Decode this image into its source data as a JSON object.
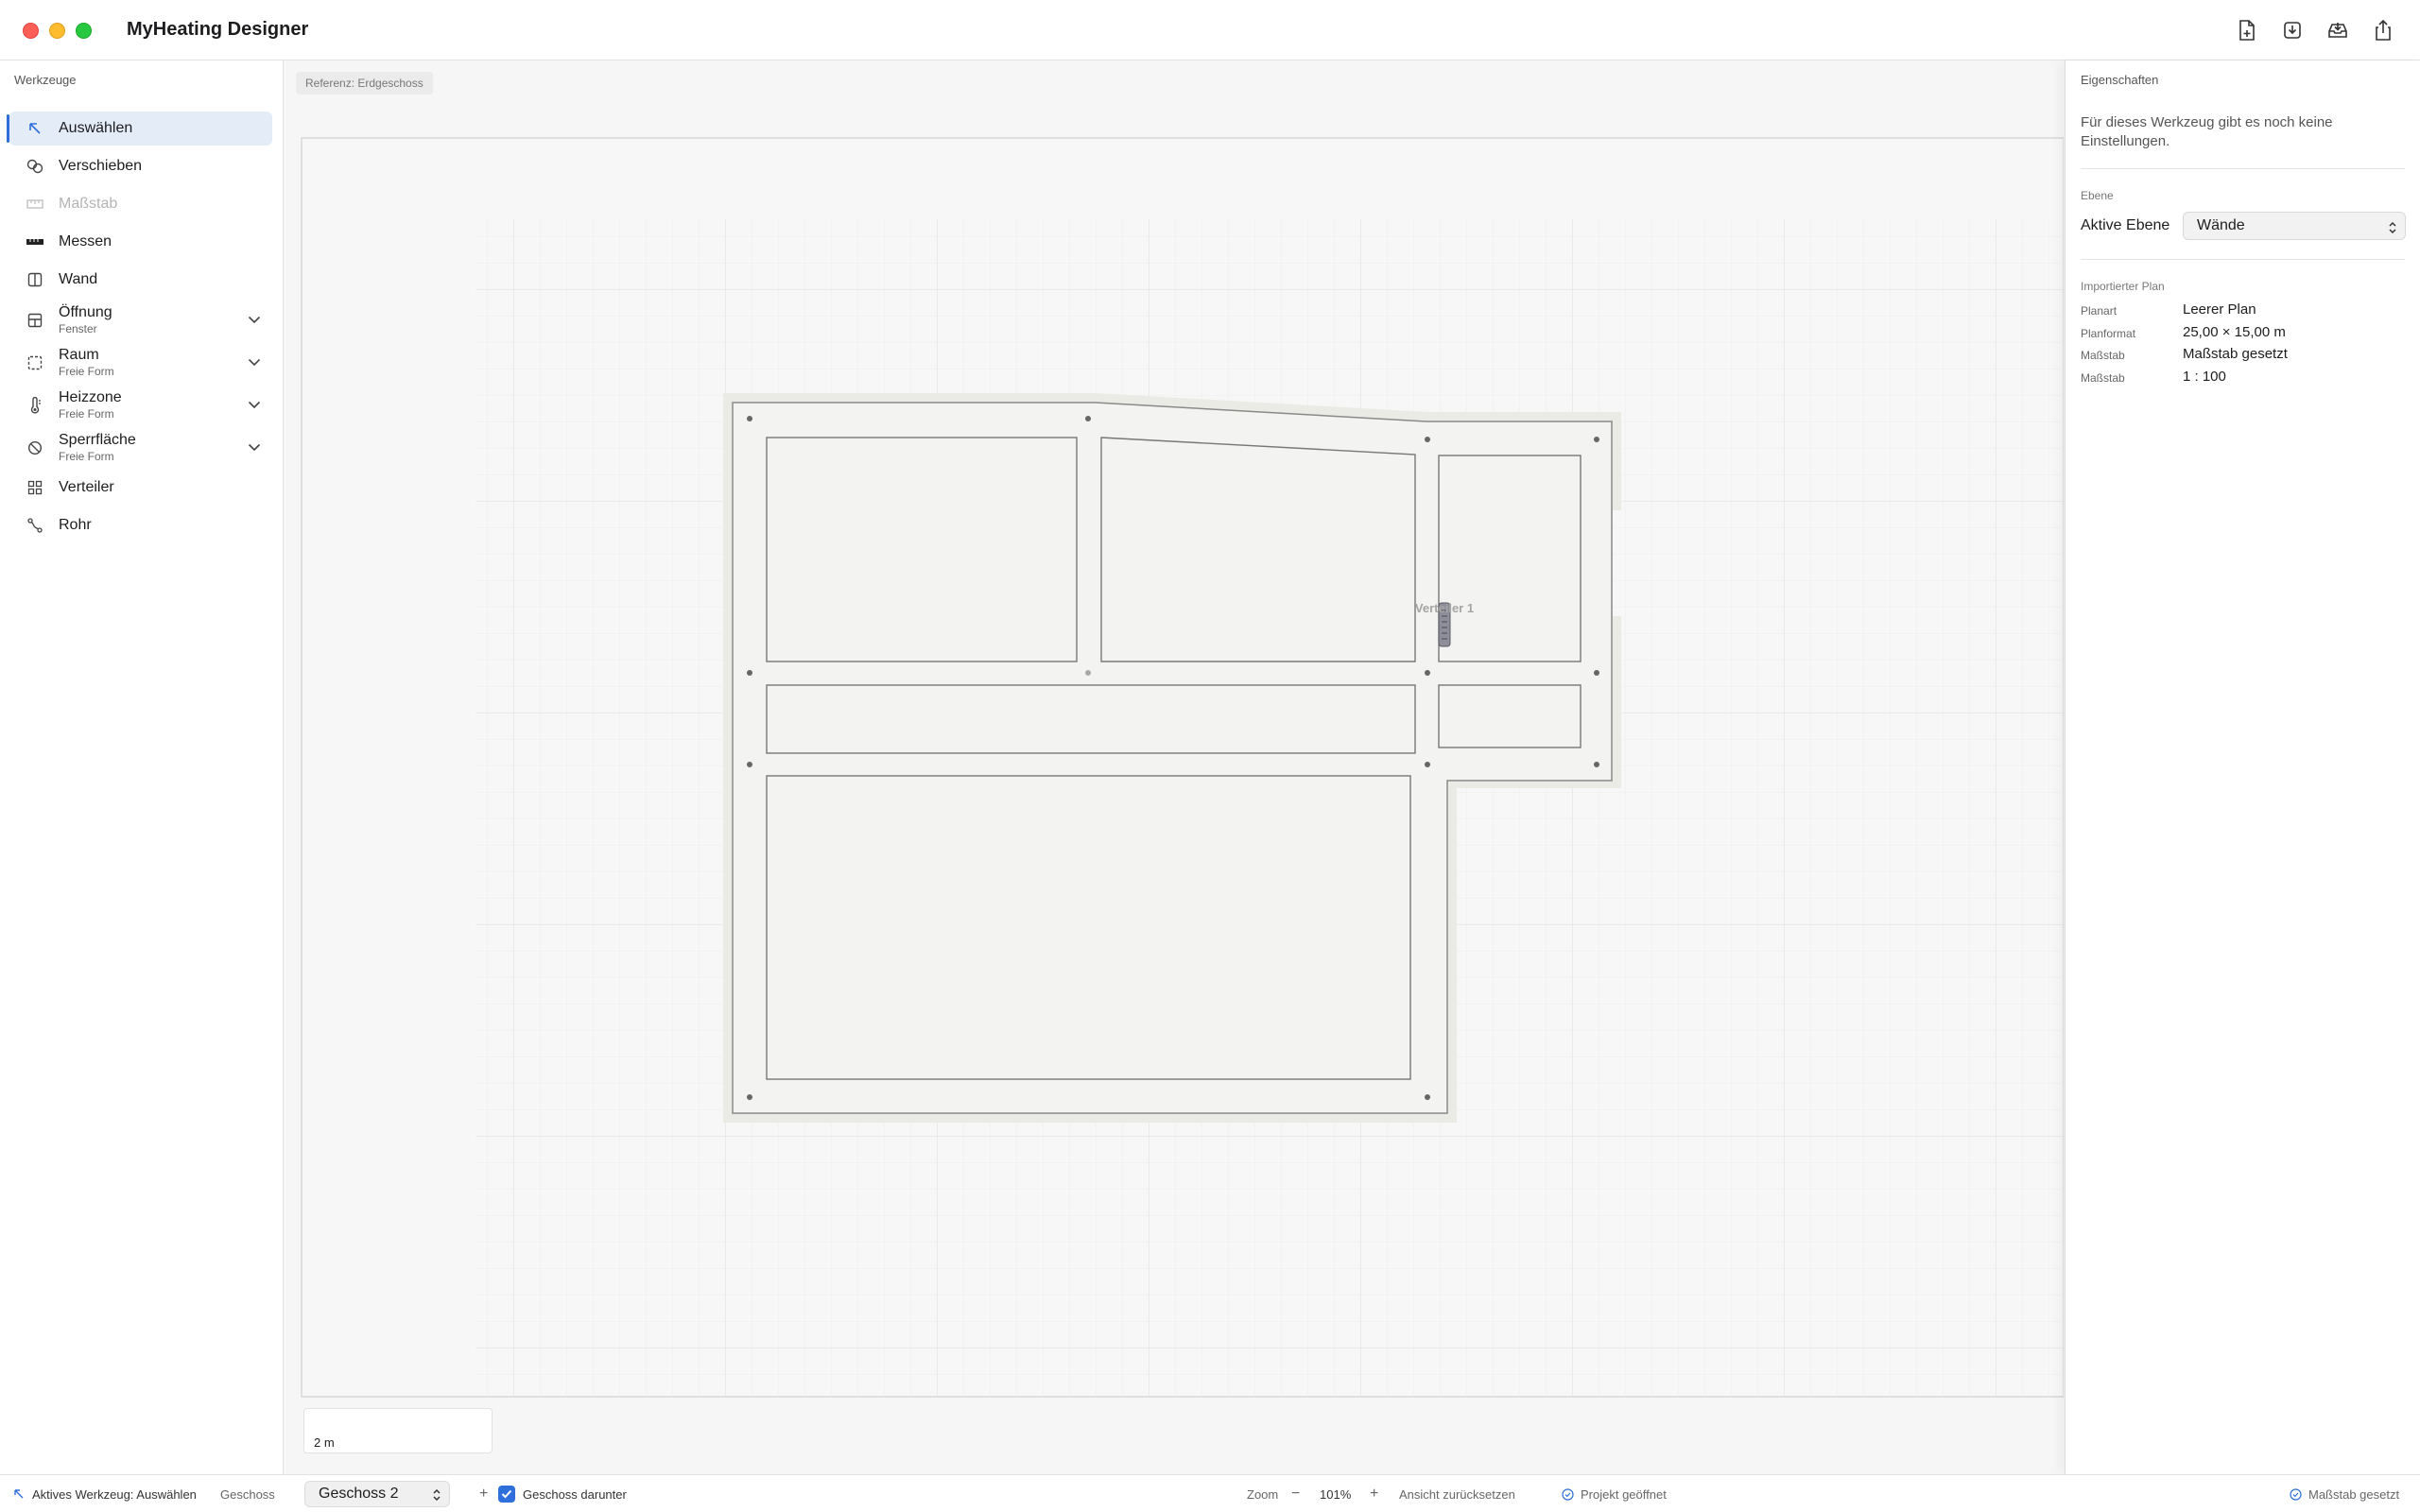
{
  "app": {
    "title": "MyHeating Designer"
  },
  "sidebar": {
    "header": "Werkzeuge",
    "tools": [
      {
        "label": "Auswählen",
        "icon": "arrow-select-icon",
        "active": true
      },
      {
        "label": "Verschieben",
        "icon": "move-icon"
      },
      {
        "label": "Maßstab",
        "icon": "ruler-icon",
        "disabled": true
      },
      {
        "label": "Messen",
        "icon": "measure-icon"
      },
      {
        "label": "Wand",
        "icon": "wall-icon"
      },
      {
        "label": "Öffnung",
        "sub": "Fenster",
        "icon": "window-icon",
        "expandable": true
      },
      {
        "label": "Raum",
        "sub": "Freie Form",
        "icon": "room-icon",
        "expandable": true
      },
      {
        "label": "Heizzone",
        "sub": "Freie Form",
        "icon": "thermometer-icon",
        "expandable": true
      },
      {
        "label": "Sperrfläche",
        "sub": "Freie Form",
        "icon": "blocked-icon",
        "expandable": true
      },
      {
        "label": "Verteiler",
        "icon": "grid-icon"
      },
      {
        "label": "Rohr",
        "icon": "pipe-icon"
      }
    ]
  },
  "canvas": {
    "reference": "Referenz: Erdgeschoss",
    "manifold_label": "Verteiler 1",
    "scale_label": "2 m"
  },
  "properties": {
    "header": "Eigenschaften",
    "note": "Für dieses Werkzeug gibt es noch keine Einstellungen.",
    "layer_section": "Ebene",
    "active_layer_label": "Aktive Ebene",
    "active_layer_value": "Wände",
    "imported_section": "Importierter Plan",
    "rows": [
      {
        "key": "Planart",
        "value": "Leerer Plan"
      },
      {
        "key": "Planformat",
        "value": "25,00 × 15,00 m"
      },
      {
        "key": "Maßstab",
        "value": "Maßstab gesetzt"
      },
      {
        "key": "Maßstab",
        "value": "1 : 100"
      }
    ]
  },
  "status": {
    "active_tool": "Aktives Werkzeug: Auswählen",
    "floor_label": "Geschoss",
    "floor_value": "Geschoss 2",
    "add": "+",
    "below_label": "Geschoss darunter",
    "zoom_label": "Zoom",
    "zoom_minus": "−",
    "zoom_value": "101%",
    "zoom_plus": "+",
    "reset_view": "Ansicht zurücksetzen",
    "project_state": "Projekt geöffnet",
    "scale_state": "Maßstab gesetzt"
  },
  "colors": {
    "accent": "#2f6fdc",
    "wall": "#8a8a8a",
    "wall_fill": "#e9e9e3"
  }
}
